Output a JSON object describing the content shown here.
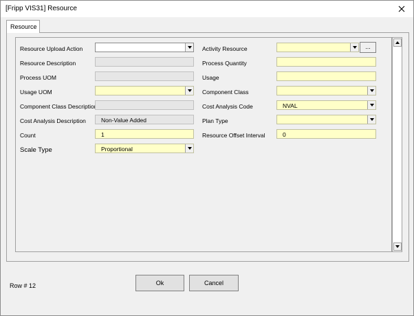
{
  "window": {
    "title": "[Fripp VIS31] Resource",
    "close_glyph": "✕"
  },
  "tab": {
    "label": "Resource"
  },
  "left_fields": [
    {
      "label": "Resource Upload Action",
      "value": "",
      "style": "white",
      "dropdown": true
    },
    {
      "label": "Resource Description",
      "value": "",
      "style": "gray",
      "dropdown": false
    },
    {
      "label": "Process UOM",
      "value": "",
      "style": "gray",
      "dropdown": false
    },
    {
      "label": "Usage UOM",
      "value": "",
      "style": "yellow",
      "dropdown": true
    },
    {
      "label": "Component Class Description",
      "value": "",
      "style": "gray",
      "dropdown": false
    },
    {
      "label": "Cost Analysis Description",
      "value": "Non-Value Added",
      "style": "gray",
      "dropdown": false
    },
    {
      "label": "Count",
      "value": "1",
      "style": "yellow",
      "dropdown": false
    },
    {
      "label": "Scale Type",
      "value": "Proportional",
      "style": "yellow",
      "dropdown": true
    }
  ],
  "right_fields": [
    {
      "label": "Activity Resource",
      "value": "",
      "style": "yellow",
      "dropdown": true
    },
    {
      "label": "Process Quantity",
      "value": "",
      "style": "yellow",
      "dropdown": false
    },
    {
      "label": "Usage",
      "value": "",
      "style": "yellow",
      "dropdown": false
    },
    {
      "label": "Component Class",
      "value": "",
      "style": "yellow",
      "dropdown": true
    },
    {
      "label": "Cost Analysis Code",
      "value": "NVAL",
      "style": "yellow",
      "dropdown": true
    },
    {
      "label": "Plan Type",
      "value": "",
      "style": "yellow",
      "dropdown": true
    },
    {
      "label": "Resource Offset Interval",
      "value": "0",
      "style": "yellow",
      "dropdown": false
    }
  ],
  "ellipsis_label": "...",
  "buttons": {
    "ok": "Ok",
    "cancel": "Cancel"
  },
  "status": {
    "row_label": "Row # 12"
  },
  "colors": {
    "field_yellow": "#ffffc8",
    "field_gray": "#e6e6e6",
    "background": "#f0f0f0"
  }
}
